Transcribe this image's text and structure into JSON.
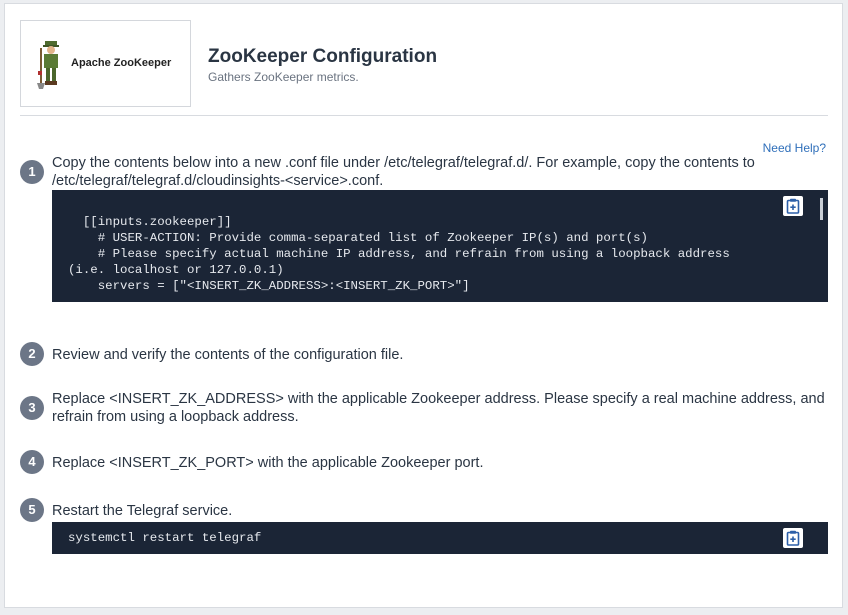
{
  "header": {
    "logo_text": "Apache ZooKeeper",
    "title": "ZooKeeper Configuration",
    "subtitle": "Gathers ZooKeeper metrics."
  },
  "help_link": "Need Help?",
  "steps": [
    {
      "number": "1",
      "text": "Copy the contents below into a new .conf file under /etc/telegraf/telegraf.d/. For example, copy the contents to /etc/telegraf/telegraf.d/cloudinsights-<service>.conf."
    },
    {
      "number": "2",
      "text": "Review and verify the contents of the configuration file."
    },
    {
      "number": "3",
      "text": "Replace <INSERT_ZK_ADDRESS> with the applicable Zookeeper address. Please specify a real machine address, and refrain from using a loopback address."
    },
    {
      "number": "4",
      "text": "Replace <INSERT_ZK_PORT> with the applicable Zookeeper port."
    },
    {
      "number": "5",
      "text": "Restart the Telegraf service."
    }
  ],
  "code_blocks": {
    "config": "  [[inputs.zookeeper]]\n    # USER-ACTION: Provide comma-separated list of Zookeeper IP(s) and port(s)\n    # Please specify actual machine IP address, and refrain from using a loopback address (i.e. localhost or 127.0.0.1)\n    servers = [\"<INSERT_ZK_ADDRESS>:<INSERT_ZK_PORT>\"]",
    "restart": "systemctl restart telegraf"
  },
  "icons": {
    "copy": "clipboard-plus-icon",
    "logo": "zookeeper-mascot-icon"
  },
  "colors": {
    "accent_link": "#2f6fba",
    "code_bg": "#1b2536",
    "step_badge": "#6c7687"
  }
}
